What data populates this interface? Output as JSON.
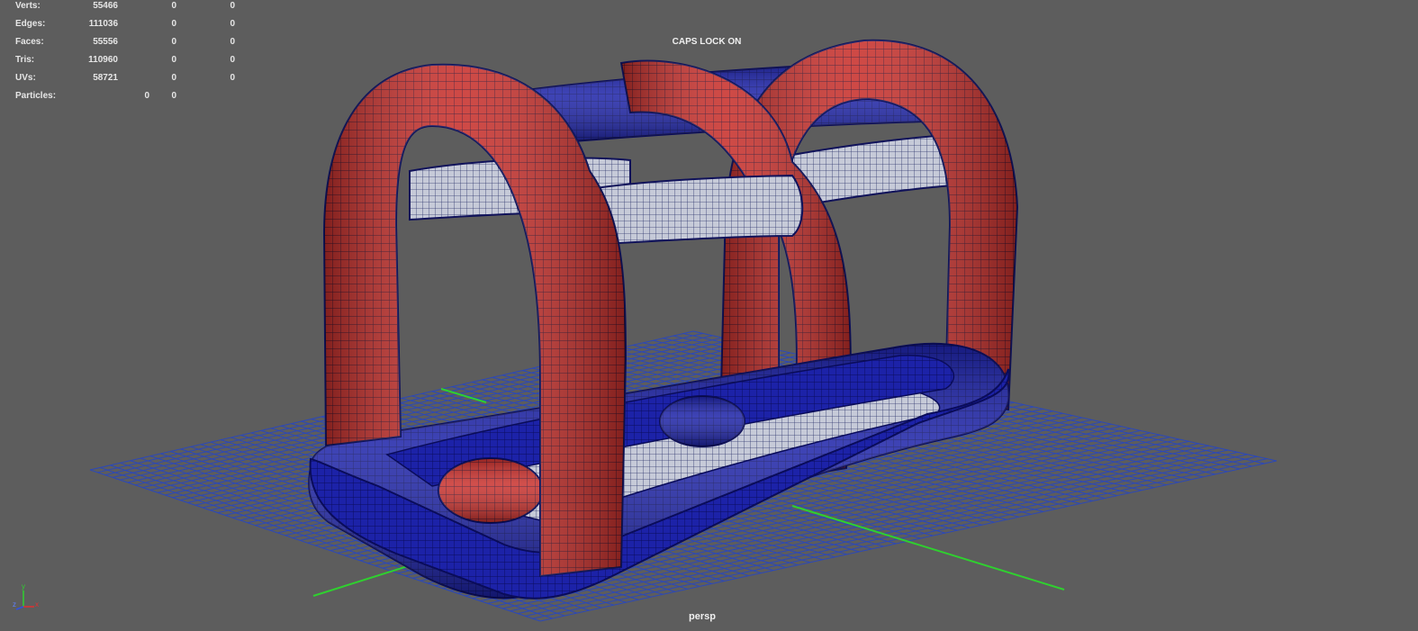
{
  "hud": {
    "rows": [
      {
        "label": "Verts:",
        "v1": "55466",
        "v2": "0",
        "v3": "0"
      },
      {
        "label": "Edges:",
        "v1": "111036",
        "v2": "0",
        "v3": "0"
      },
      {
        "label": "Faces:",
        "v1": "55556",
        "v2": "0",
        "v3": "0"
      },
      {
        "label": "Tris:",
        "v1": "110960",
        "v2": "0",
        "v3": "0"
      },
      {
        "label": "UVs:",
        "v1": "58721",
        "v2": "0",
        "v3": "0"
      }
    ],
    "particles": {
      "label": "Particles:",
      "v1": "0",
      "v2": "0"
    }
  },
  "status": {
    "caps_lock": "CAPS LOCK ON"
  },
  "camera": {
    "name": "persp"
  },
  "axis_gizmo": {
    "y": "y",
    "z": "z",
    "x": "x"
  },
  "colors": {
    "background": "#5d5d5d",
    "grid": "#2c48b8",
    "axis_green": "#2fd02f",
    "tube_red": "#c8302c",
    "tube_blue": "#1c20a8",
    "tube_white": "#c6cad8",
    "wire": "#0d0d55"
  }
}
